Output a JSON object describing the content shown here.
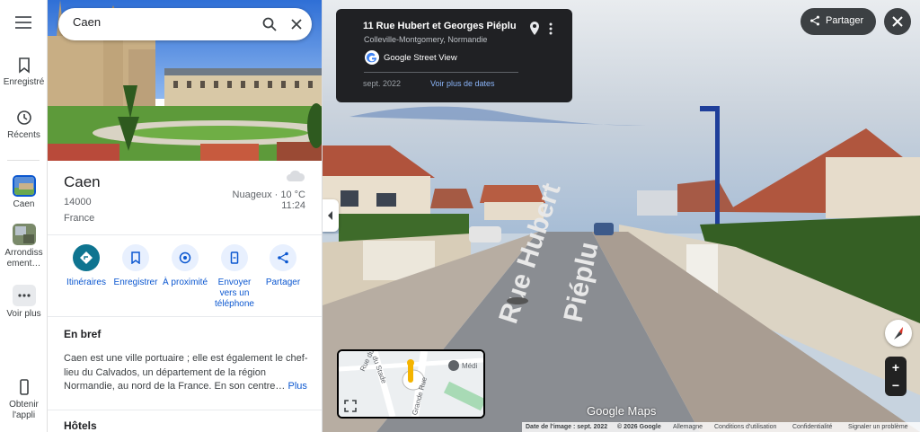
{
  "rail": {
    "menu_icon": "menu-icon",
    "items": [
      {
        "label": "Enregistré",
        "icon": "bookmark-icon"
      },
      {
        "label": "Récents",
        "icon": "history-icon"
      },
      {
        "label": "Caen",
        "icon": "caen-thumbnail"
      },
      {
        "label": "Arrondissement…",
        "label_line1": "Arrondiss",
        "label_line2": "ement…",
        "icon": "arrondissement-thumbnail"
      },
      {
        "label": "Voir plus",
        "icon": "more-horiz-icon"
      },
      {
        "label": "Obtenir l'appli",
        "label_line1": "Obtenir",
        "label_line2": "l'appli",
        "icon": "phone-icon"
      }
    ]
  },
  "search": {
    "value": "Caen"
  },
  "place": {
    "title": "Caen",
    "zip": "14000",
    "country": "France",
    "weather_line1": "Nuageux · 10 °C",
    "weather_time": "11:24",
    "weather_icon": "cloud-icon"
  },
  "actions": [
    {
      "label": "Itinéraires",
      "icon": "directions-icon"
    },
    {
      "label": "Enregistrer",
      "icon": "bookmark-icon"
    },
    {
      "label": "À proximité",
      "icon": "nearby-icon"
    },
    {
      "label": "Envoyer vers un téléphone",
      "line1": "Envoyer",
      "line2": "vers un",
      "line3": "téléphone",
      "icon": "send-to-phone-icon"
    },
    {
      "label": "Partager",
      "icon": "share-icon"
    }
  ],
  "brief": {
    "heading": "En bref",
    "text": "Caen est une ville portuaire ; elle est également le chef-lieu du Calvados, un département de la région Normandie, au nord de la France. En son centre…",
    "more": "Plus"
  },
  "hotels": {
    "heading": "Hôtels"
  },
  "streetview": {
    "address": "11 Rue Hubert et Georges Piéplu",
    "city": "Colleville-Montgomery, Normandie",
    "provider": "Google Street View",
    "date": "sept. 2022",
    "more_dates": "Voir plus de dates",
    "share_label": "Partager",
    "minimap_labels": [
      "du Stade",
      "Rue du Crespley",
      "Grande Rue",
      "Médi"
    ],
    "watermark": "Google Maps",
    "road_text_1": "Rue Hubert",
    "road_text_2": "Piéplu",
    "footer": [
      "Date de l'image : sept. 2022",
      "© 2026 Google",
      "Allemagne",
      "Conditions d'utilisation",
      "Confidentialité",
      "Signaler un problème"
    ],
    "zoom_in": "+",
    "zoom_out": "−"
  },
  "colors": {
    "accent": "#0b57d0",
    "primary_action": "#0e7490",
    "dark_panel": "#202124"
  }
}
